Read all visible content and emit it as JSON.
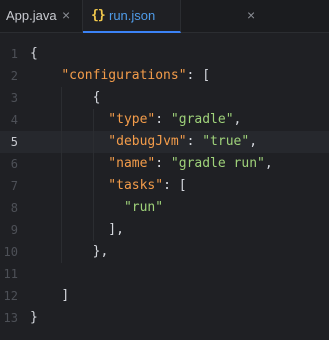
{
  "tabs": [
    {
      "label": "App.java",
      "active": false,
      "close_icon": "×"
    },
    {
      "label": "run.json",
      "active": true,
      "file_icon": "{}",
      "close_icon": "×"
    }
  ],
  "editor": {
    "current_line": 5,
    "lines": [
      {
        "num": "1",
        "indent": 0,
        "parts": [
          {
            "t": "{",
            "c": "p"
          }
        ]
      },
      {
        "num": "2",
        "indent": 4,
        "parts": [
          {
            "t": "\"configurations\"",
            "c": "k"
          },
          {
            "t": ": [",
            "c": "p"
          }
        ]
      },
      {
        "num": "3",
        "indent": 8,
        "parts": [
          {
            "t": "{",
            "c": "p"
          }
        ]
      },
      {
        "num": "4",
        "indent": 10,
        "parts": [
          {
            "t": "\"type\"",
            "c": "k"
          },
          {
            "t": ": ",
            "c": "p"
          },
          {
            "t": "\"gradle\"",
            "c": "s"
          },
          {
            "t": ",",
            "c": "p"
          }
        ]
      },
      {
        "num": "5",
        "indent": 10,
        "parts": [
          {
            "t": "\"debugJvm\"",
            "c": "k"
          },
          {
            "t": ": ",
            "c": "p"
          },
          {
            "t": "\"true\"",
            "c": "s"
          },
          {
            "t": ",",
            "c": "p"
          }
        ]
      },
      {
        "num": "6",
        "indent": 10,
        "parts": [
          {
            "t": "\"name\"",
            "c": "k"
          },
          {
            "t": ": ",
            "c": "p"
          },
          {
            "t": "\"gradle run\"",
            "c": "s"
          },
          {
            "t": ",",
            "c": "p"
          }
        ]
      },
      {
        "num": "7",
        "indent": 10,
        "parts": [
          {
            "t": "\"tasks\"",
            "c": "k"
          },
          {
            "t": ": [",
            "c": "p"
          }
        ]
      },
      {
        "num": "8",
        "indent": 12,
        "parts": [
          {
            "t": "\"run\"",
            "c": "s"
          }
        ]
      },
      {
        "num": "9",
        "indent": 10,
        "parts": [
          {
            "t": "],",
            "c": "p"
          }
        ]
      },
      {
        "num": "10",
        "indent": 8,
        "parts": [
          {
            "t": "},",
            "c": "p"
          }
        ]
      },
      {
        "num": "11",
        "indent": 0,
        "parts": []
      },
      {
        "num": "12",
        "indent": 4,
        "parts": [
          {
            "t": "]",
            "c": "p"
          }
        ]
      },
      {
        "num": "13",
        "indent": 0,
        "parts": [
          {
            "t": "}",
            "c": "p"
          }
        ]
      }
    ]
  }
}
